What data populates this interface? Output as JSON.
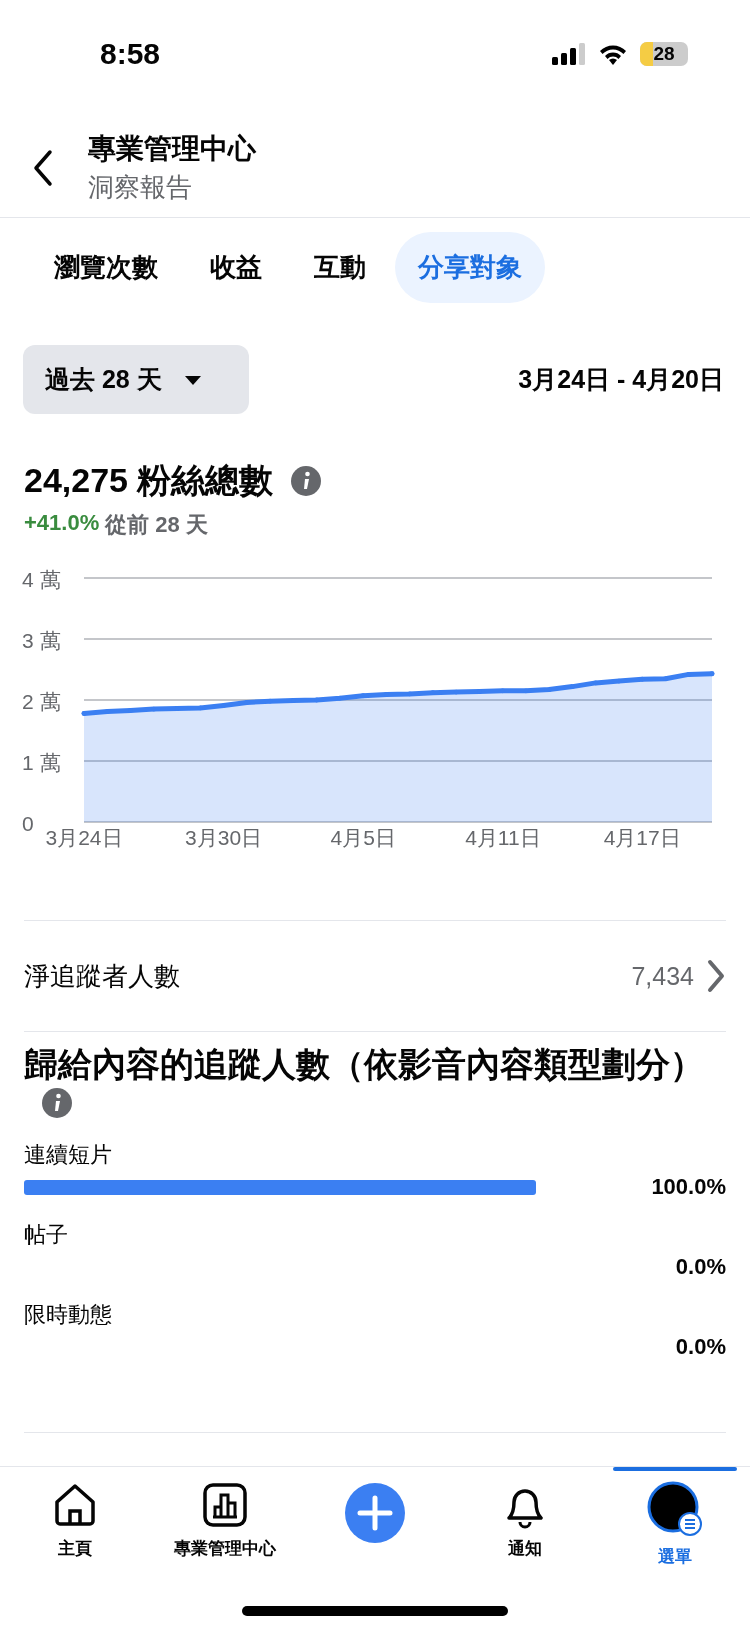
{
  "status_bar": {
    "time": "8:58",
    "battery": "28"
  },
  "header": {
    "title": "專業管理中心",
    "subtitle": "洞察報告"
  },
  "tabs": [
    {
      "label": "瀏覽次數",
      "selected": false
    },
    {
      "label": "收益",
      "selected": false
    },
    {
      "label": "互動",
      "selected": false
    },
    {
      "label": "分享對象",
      "selected": true
    }
  ],
  "range": {
    "label": "過去 28 天",
    "dates": "3月24日 - 4月20日"
  },
  "summary": {
    "value": "24,275 粉絲總數",
    "change": "+41.0%",
    "compare": "從前 28 天",
    "chart_data": {
      "type": "area",
      "categories": [
        "3月24日",
        null,
        null,
        null,
        null,
        null,
        "3月30日",
        null,
        null,
        null,
        null,
        null,
        "4月5日",
        null,
        null,
        null,
        null,
        null,
        "4月11日",
        null,
        null,
        null,
        null,
        null,
        "4月17日",
        null,
        null,
        null
      ],
      "grid": true,
      "series": [
        {
          "color": "#3b7ff2",
          "values": [
            1.78,
            1.81,
            1.83,
            1.85,
            1.86,
            1.87,
            1.91,
            1.96,
            1.98,
            1.99,
            2.0,
            2.03,
            2.07,
            2.09,
            2.1,
            2.12,
            2.13,
            2.14,
            2.15,
            2.15,
            2.17,
            2.22,
            2.28,
            2.31,
            2.34,
            2.35,
            2.42,
            2.43
          ]
        }
      ],
      "ylim": [
        0,
        4
      ],
      "yticks": [
        {
          "value": 0,
          "label": "0"
        },
        {
          "value": 1,
          "label": "1 萬"
        },
        {
          "value": 2,
          "label": "2 萬"
        },
        {
          "value": 3,
          "label": "3 萬"
        },
        {
          "value": 4,
          "label": "4 萬"
        }
      ]
    }
  },
  "net_followers": {
    "label": "淨追蹤者人數",
    "value": "7,434"
  },
  "breakdown": {
    "title": "歸給內容的追蹤人數（依影音內容類型劃分）",
    "items": [
      {
        "name": "連續短片",
        "kind": "bar",
        "reading": "100.0%"
      },
      {
        "name": "帖子",
        "kind": "plain",
        "reading": "0.0%"
      },
      {
        "name": "限時動態",
        "kind": "plain",
        "reading": "0.0%"
      }
    ]
  },
  "nav": [
    {
      "kind": "home",
      "label": "主頁",
      "selected": false
    },
    {
      "kind": "insights",
      "label": "專業管理中心",
      "selected": false
    },
    {
      "kind": "create",
      "selected": false
    },
    {
      "kind": "bell",
      "label": "通知",
      "selected": false
    },
    {
      "kind": "avatar",
      "label": "選單",
      "selected": true
    }
  ]
}
